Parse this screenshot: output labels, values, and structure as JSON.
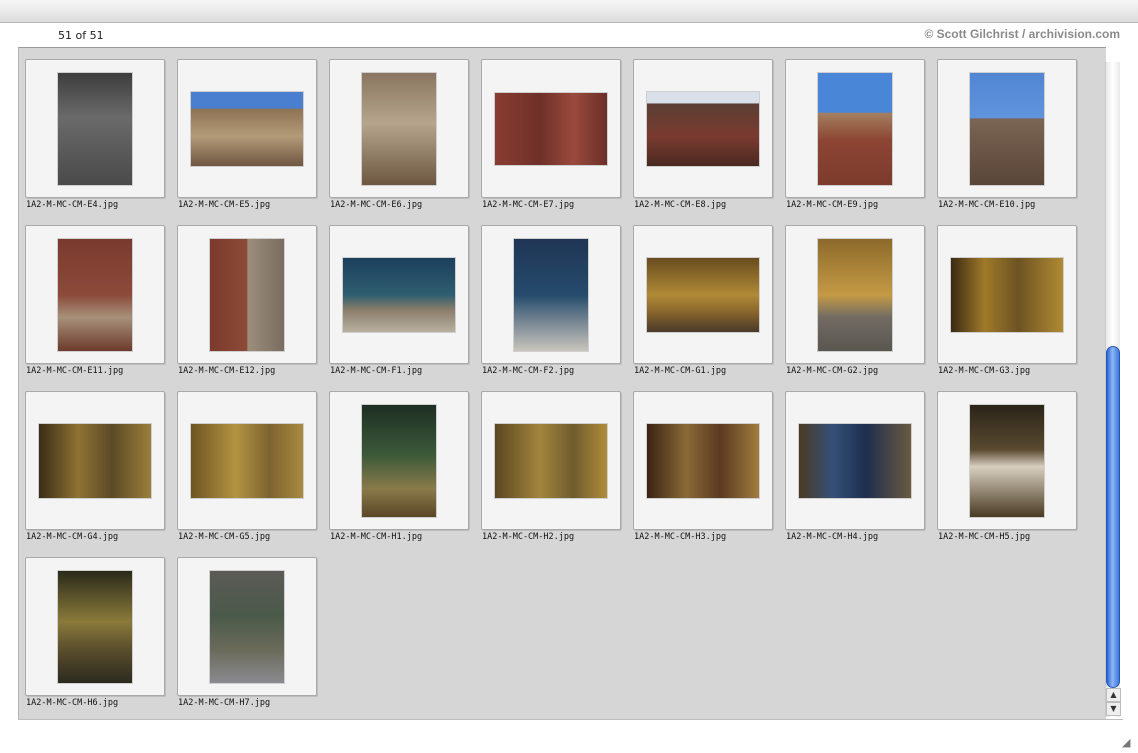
{
  "header": {
    "count": "51 of 51",
    "credit": "© Scott Gilchrist / archivision.com"
  },
  "icons": {
    "scroll_up": "up-arrow-icon",
    "scroll_down": "down-arrow-icon",
    "resize": "resize-grip-icon"
  },
  "thumbnails": [
    {
      "file": "1A2-M-MC-CM-E4.jpg"
    },
    {
      "file": "1A2-M-MC-CM-E5.jpg"
    },
    {
      "file": "1A2-M-MC-CM-E6.jpg"
    },
    {
      "file": "1A2-M-MC-CM-E7.jpg"
    },
    {
      "file": "1A2-M-MC-CM-E8.jpg"
    },
    {
      "file": "1A2-M-MC-CM-E9.jpg"
    },
    {
      "file": "1A2-M-MC-CM-E10.jpg"
    },
    {
      "file": "1A2-M-MC-CM-E11.jpg"
    },
    {
      "file": "1A2-M-MC-CM-E12.jpg"
    },
    {
      "file": "1A2-M-MC-CM-F1.jpg"
    },
    {
      "file": "1A2-M-MC-CM-F2.jpg"
    },
    {
      "file": "1A2-M-MC-CM-G1.jpg"
    },
    {
      "file": "1A2-M-MC-CM-G2.jpg"
    },
    {
      "file": "1A2-M-MC-CM-G3.jpg"
    },
    {
      "file": "1A2-M-MC-CM-G4.jpg"
    },
    {
      "file": "1A2-M-MC-CM-G5.jpg"
    },
    {
      "file": "1A2-M-MC-CM-H1.jpg"
    },
    {
      "file": "1A2-M-MC-CM-H2.jpg"
    },
    {
      "file": "1A2-M-MC-CM-H3.jpg"
    },
    {
      "file": "1A2-M-MC-CM-H4.jpg"
    },
    {
      "file": "1A2-M-MC-CM-H5.jpg"
    },
    {
      "file": "1A2-M-MC-CM-H6.jpg"
    },
    {
      "file": "1A2-M-MC-CM-H7.jpg"
    }
  ]
}
